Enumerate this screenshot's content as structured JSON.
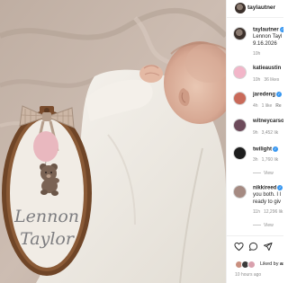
{
  "post": {
    "author": "taylautner",
    "photo": {
      "description": "newborn sleeping beside embroidery hoop",
      "embroidery_line1": "Lennon",
      "embroidery_line2": "Taylor"
    }
  },
  "caption": {
    "username": "taylautner",
    "line1": "Lennon Tayl",
    "line2": "9.16.2026",
    "time": "10h"
  },
  "comments": [
    {
      "username": "katieaustin",
      "time": "10h",
      "likes": "36 likes",
      "avatar_color": "#f2b6c9"
    },
    {
      "username": "jaredeng",
      "time": "4h",
      "likes": "1 like",
      "reply": "Re",
      "avatar_color": "#c96a5a"
    },
    {
      "username": "witneycarso",
      "time": "9h",
      "likes": "3,452 lik",
      "avatar_color": "#6d4b5b"
    },
    {
      "username": "twilight",
      "time": "3h",
      "likes": "1,760 lik",
      "view": "View",
      "avatar_color": "#1d1d1d"
    },
    {
      "username": "nikkireed",
      "text_line1": "you both. I l",
      "text_line2": "ready to giv",
      "time": "11h",
      "likes": "12,296 lik",
      "view": "View",
      "avatar_color": "#a58a82"
    }
  ],
  "actions": {
    "icons": [
      "heart-icon",
      "comment-icon",
      "share-icon"
    ],
    "liked_by_prefix": "Liked by",
    "liked_by_user": "as",
    "time_ago": "10 hours ago"
  },
  "colors": {
    "verified": "#3897f0",
    "text": "#262626",
    "muted": "#8e8e8e",
    "blanket": "#c9b9ad",
    "sleeper": "#f3efe8",
    "hoop_wood": "#8a5a36",
    "embroidery_text": "#7d7d80",
    "balloon": "#e9b8bf"
  }
}
